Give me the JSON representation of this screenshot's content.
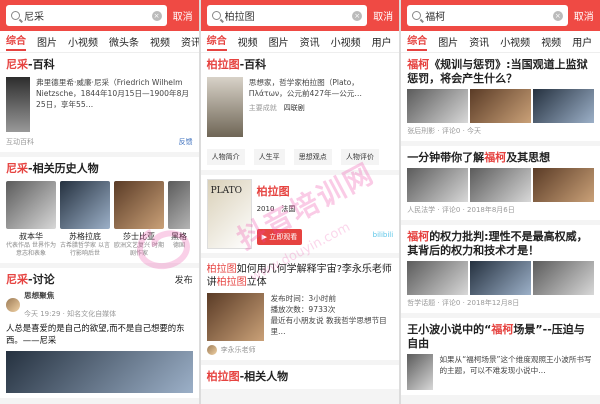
{
  "panels": [
    {
      "search": "尼采",
      "cancel": "取消",
      "tabs": [
        "综合",
        "图片",
        "小视频",
        "微头条",
        "视频",
        "资讯"
      ],
      "wiki": {
        "title_red": "尼采",
        "title_rest": "-百科",
        "desc": "弗里德里希·威廉·尼采（Friedrich Wilhelm Nietzsche，1844年10月15日—1900年8月25日，享年55…",
        "source": "互动百科",
        "action": "反馈"
      },
      "related": {
        "title_red": "尼采",
        "title_rest": "-相关历史人物",
        "people": [
          {
            "name": "叔本华",
            "desc": "代表作品 世界作为意志和表象"
          },
          {
            "name": "苏格拉底",
            "desc": "古希腊哲学家 以言行影响后世"
          },
          {
            "name": "莎士比亚",
            "desc": "欧洲文艺复兴 时期剧作家"
          },
          {
            "name": "黑格",
            "desc": "德国"
          }
        ]
      },
      "discussion": {
        "title_red": "尼采",
        "title_rest": "-讨论",
        "publish": "发布",
        "author": "思想聚焦",
        "time": "今天 19:29 · 知名文化自媒体",
        "text": "人总是喜爱的是自己的欲望,而不是自己想要的东西。——尼采"
      }
    },
    {
      "search": "柏拉图",
      "cancel": "取消",
      "tabs": [
        "综合",
        "视频",
        "图片",
        "资讯",
        "小视频",
        "用户",
        "音"
      ],
      "wiki": {
        "title_red": "柏拉图",
        "title_rest": "-百科",
        "desc": "思想家，哲学家柏拉图（Plato，Πλάτων，公元前427年—公元…",
        "label": "主要成就",
        "value": "四联剧"
      },
      "buttons": [
        "人物简介",
        "人生平",
        "思想观点",
        "人物评价"
      ],
      "video": {
        "brand": "PLATO",
        "title": "柏拉图",
        "year": "2010",
        "country": "法国",
        "play": "立即观看",
        "site": "bilibili"
      },
      "article": {
        "title_start": "柏拉图",
        "title_mid": "如何用几何学解释宇宙?李永乐老师讲",
        "title_end_red": "柏拉图",
        "title_end": "立体",
        "time": "发布时间：3小时前",
        "plays": "播放次数：9733次",
        "note": "最近有小朋友说 教我哲学思想节目里…",
        "author": "李永乐老师"
      },
      "related": {
        "title_red": "柏拉图",
        "title_rest": "-相关人物"
      }
    },
    {
      "search": "福柯",
      "cancel": "取消",
      "tabs": [
        "综合",
        "图片",
        "资讯",
        "小视频",
        "视频",
        "用户",
        "音"
      ],
      "items": [
        {
          "title_red": "福柯",
          "title_rest": "《规训与惩罚》:当国观道上监狱惩罚，将会产生什么？",
          "source": "张后刑影",
          "comments": "评论0",
          "time": "今天"
        },
        {
          "title_start": "一分钟带你了解",
          "title_red": "福柯",
          "title_end": "及其思想",
          "source": "人民法学",
          "comments": "评论0",
          "time": "2018年8月6日"
        },
        {
          "title_red": "福柯",
          "title_rest": "的权力批判:理性不是最高权威，其背后的权力和技术才是！",
          "source": "哲学话题",
          "comments": "评论0",
          "time": "2018年12月8日"
        },
        {
          "title_start": "王小波小说中的“",
          "title_red": "福柯",
          "title_mid": "场景”--压迫与自由",
          "excerpt": "如果从“福柯场景”这个维度观照王小波所书写的主题，可以不难发现小说中…"
        }
      ]
    }
  ],
  "watermark": {
    "main": "抖音培训网",
    "url": "www.douyin.com"
  },
  "colors": {
    "accent": "#e64340",
    "header": "#ef4a44",
    "link": "#3a6ebd"
  }
}
